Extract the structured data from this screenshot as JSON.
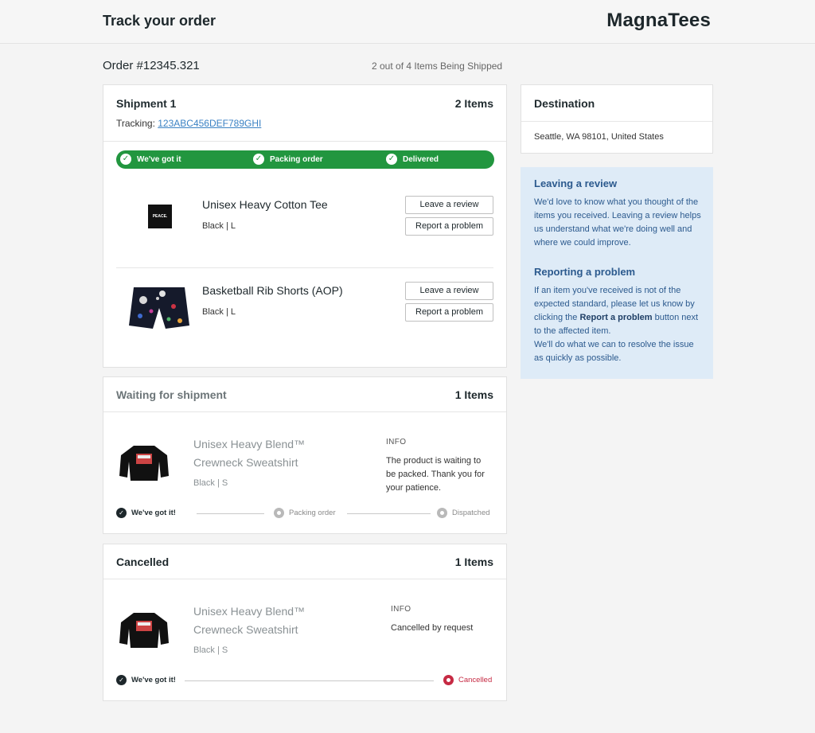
{
  "header": {
    "title": "Track your order",
    "brand": "MagnaTees"
  },
  "order": {
    "number": "Order #12345.321",
    "shipping_summary": "2 out of 4 Items Being Shipped"
  },
  "shipment1": {
    "title": "Shipment 1",
    "count": "2 Items",
    "tracking_label": "Tracking:",
    "tracking_number": "123ABC456DEF789GHI",
    "progress": [
      "We've got it",
      "Packing order",
      "Delivered"
    ],
    "items": [
      {
        "name": "Unisex Heavy Cotton Tee",
        "variant": "Black | L",
        "shirt_text": "PEACE.",
        "review_label": "Leave a review",
        "problem_label": "Report a problem"
      },
      {
        "name": "Basketball Rib Shorts (AOP)",
        "variant": "Black | L",
        "review_label": "Leave a review",
        "problem_label": "Report a problem"
      }
    ]
  },
  "waiting": {
    "title": "Waiting for shipment",
    "count": "1 Items",
    "item_name": "Unisex Heavy Blend™ Crewneck Sweatshirt",
    "variant": "Black | S",
    "info_label": "INFO",
    "info_text": "The product is waiting to be packed. Thank you for your patience.",
    "steps": [
      "We've got it!",
      "Packing order",
      "Dispatched"
    ]
  },
  "cancelled": {
    "title": "Cancelled",
    "count": "1 Items",
    "item_name": "Unisex Heavy Blend™ Crewneck Sweatshirt",
    "variant": "Black | S",
    "info_label": "INFO",
    "info_text": "Cancelled by request",
    "steps": [
      "We've got it!",
      "Cancelled"
    ]
  },
  "destination": {
    "title": "Destination",
    "address": "Seattle, WA 98101, United States"
  },
  "help": {
    "review_title": "Leaving a review",
    "review_text": "We'd love to know what you thought of the items you received. Leaving a review helps us understand what we're doing well and where we could improve.",
    "problem_title": "Reporting a problem",
    "problem_text_1": "If an item you've received is not of the expected standard, please let us know by clicking the",
    "problem_bold": "Report a problem",
    "problem_text_2": "button next to the affected item.",
    "problem_text_3": "We'll do what we can to resolve the issue as quickly as possible."
  },
  "colors": {
    "progress_green": "#22963f",
    "link_blue": "#3b82c4",
    "help_bg": "#deebf7",
    "help_text": "#2c5a8e",
    "cancel_red": "#c62a43"
  }
}
